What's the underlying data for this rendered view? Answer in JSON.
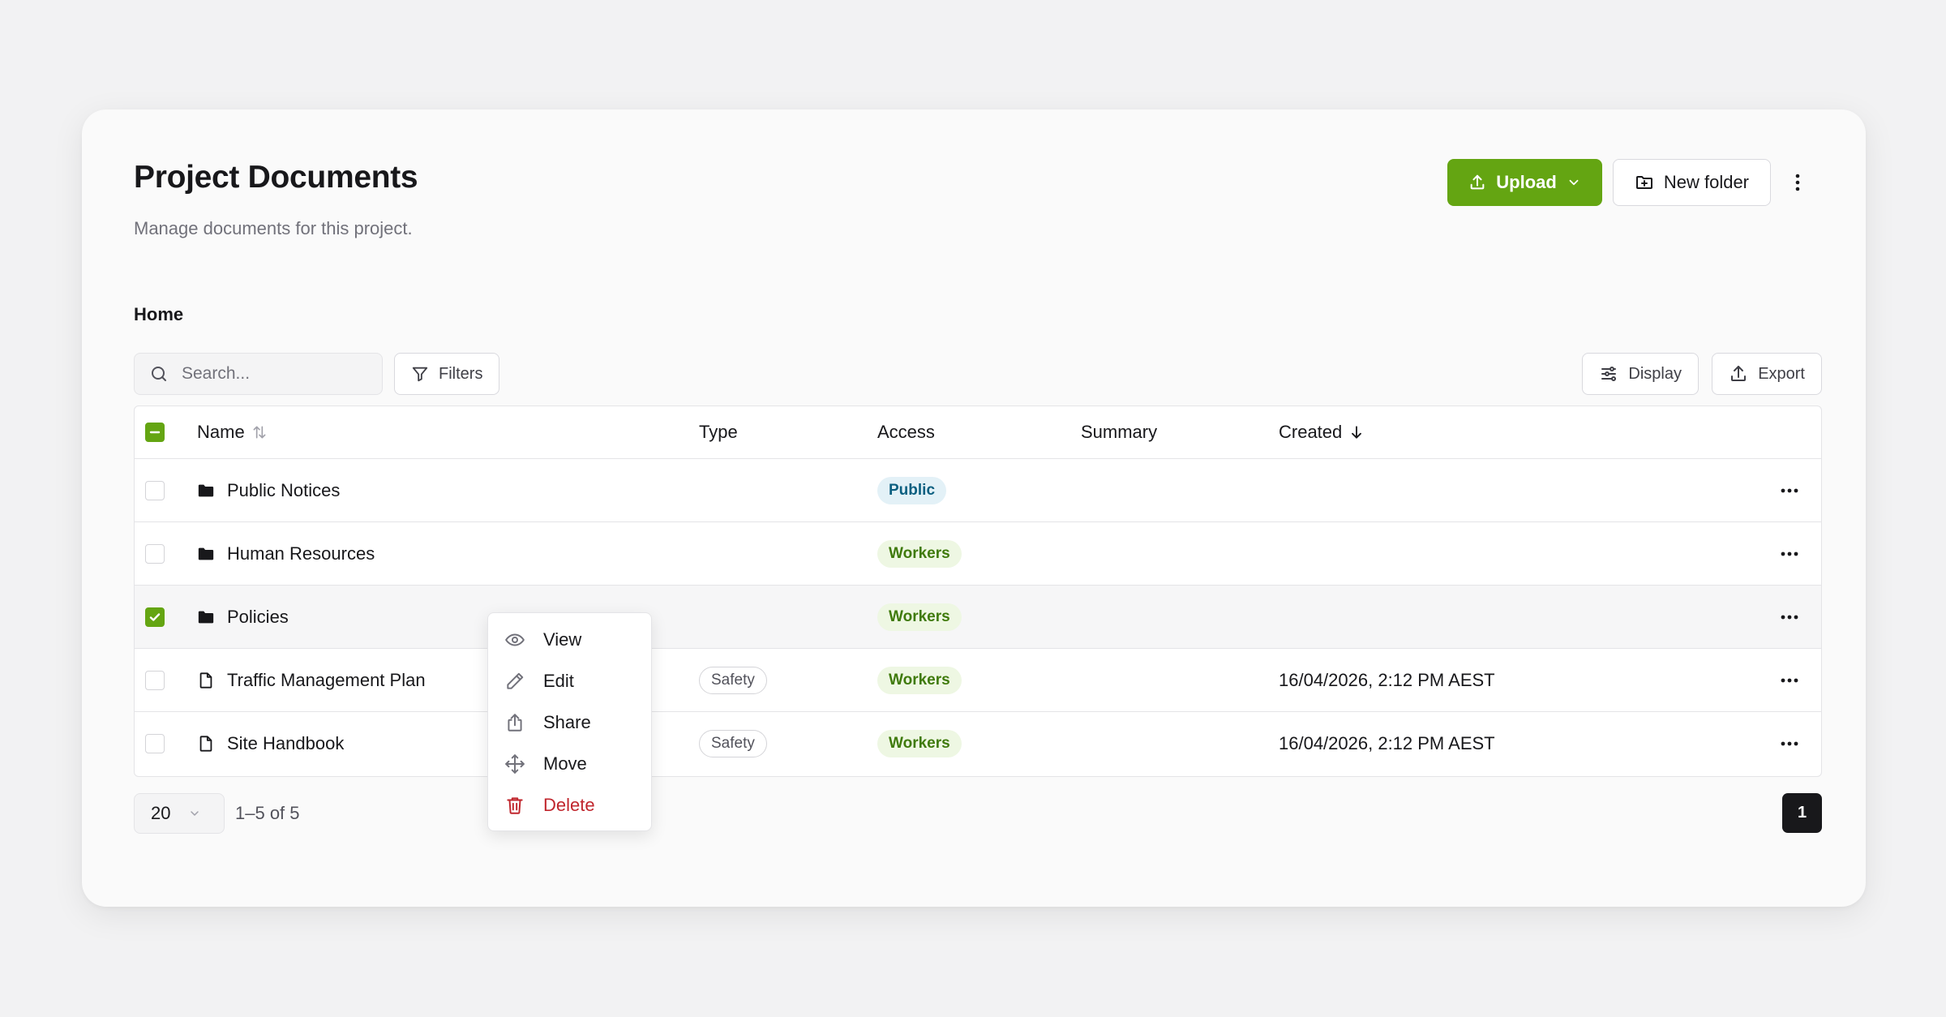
{
  "header": {
    "title": "Project Documents",
    "subtitle": "Manage documents for this project.",
    "upload_label": "Upload",
    "new_folder_label": "New folder"
  },
  "breadcrumb": "Home",
  "toolbar": {
    "search_placeholder": "Search...",
    "filters_label": "Filters",
    "display_label": "Display",
    "export_label": "Export"
  },
  "table": {
    "columns": {
      "name": "Name",
      "type": "Type",
      "access": "Access",
      "summary": "Summary",
      "created": "Created"
    },
    "rows": [
      {
        "name": "Public Notices",
        "kind": "folder",
        "type": "",
        "access": "Public",
        "summary": "",
        "created": "",
        "selected": false
      },
      {
        "name": "Human Resources",
        "kind": "folder",
        "type": "",
        "access": "Workers",
        "summary": "",
        "created": "",
        "selected": false
      },
      {
        "name": "Policies",
        "kind": "folder",
        "type": "",
        "access": "Workers",
        "summary": "",
        "created": "",
        "selected": true
      },
      {
        "name": "Traffic Management Plan",
        "kind": "file",
        "type": "Safety",
        "access": "Workers",
        "summary": "",
        "created": "16/04/2026, 2:12 PM AEST",
        "selected": false
      },
      {
        "name": "Site Handbook",
        "kind": "file",
        "type": "Safety",
        "access": "Workers",
        "summary": "",
        "created": "16/04/2026, 2:12 PM AEST",
        "selected": false
      }
    ]
  },
  "pagination": {
    "page_size": "20",
    "range": "1–5 of 5",
    "current_page": "1"
  },
  "context_menu": {
    "items": [
      {
        "label": "View",
        "icon": "eye-icon"
      },
      {
        "label": "Edit",
        "icon": "pencil-icon"
      },
      {
        "label": "Share",
        "icon": "share-icon"
      },
      {
        "label": "Move",
        "icon": "move-icon"
      },
      {
        "label": "Delete",
        "icon": "trash-icon"
      }
    ]
  },
  "colors": {
    "accent": "#64a512",
    "danger": "#c0262d",
    "public_badge": "#e3f1f7",
    "workers_badge": "#eef7e3"
  }
}
